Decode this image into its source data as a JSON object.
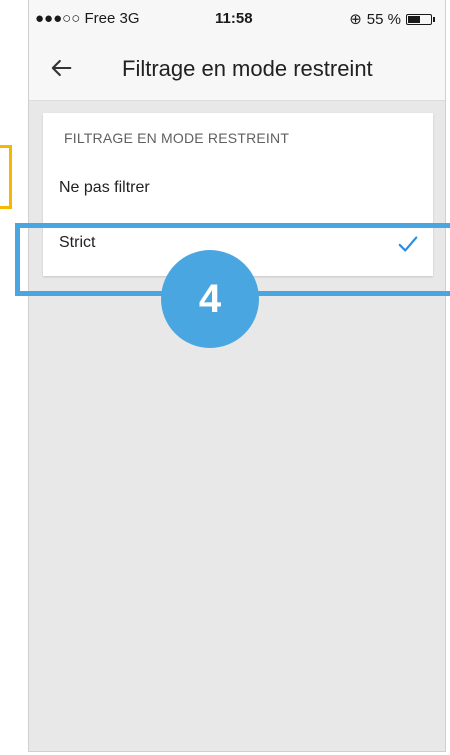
{
  "status_bar": {
    "carrier": "●●●○○ Free  3G",
    "time": "11:58",
    "lock_glyph": "⊕",
    "battery_text": "55 %",
    "battery_level": 0.55
  },
  "app_bar": {
    "back_icon": "arrow-left-icon",
    "title": "Filtrage en mode restreint"
  },
  "section": {
    "header": "FILTRAGE EN MODE RESTREINT",
    "options": [
      {
        "label": "Ne pas filtrer",
        "selected": false
      },
      {
        "label": "Strict",
        "selected": true
      }
    ]
  },
  "annotations": {
    "step_number": "4",
    "highlight_color": "#4aa6e0",
    "secondary_marker_color": "#f5b800"
  },
  "colors": {
    "check": "#2b8ee0",
    "background": "#e8e8e8"
  }
}
